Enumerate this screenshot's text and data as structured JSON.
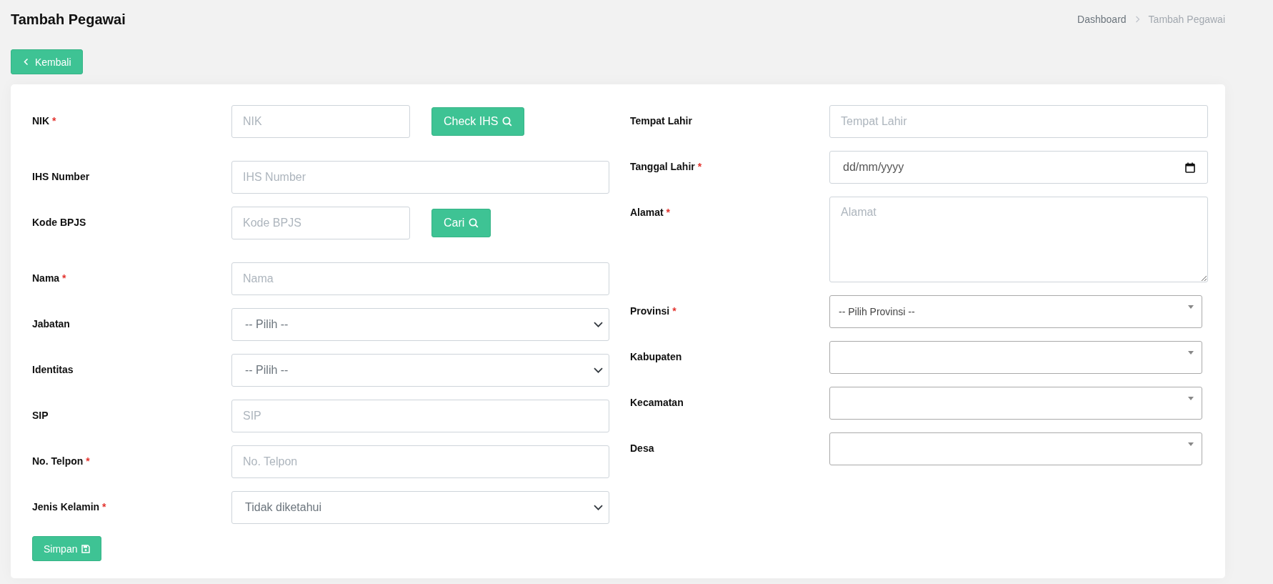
{
  "page": {
    "title": "Tambah Pegawai"
  },
  "breadcrumb": [
    {
      "label": "Dashboard",
      "active": false
    },
    {
      "label": "Tambah Pegawai",
      "active": true
    }
  ],
  "back_button": {
    "label": "Kembali"
  },
  "left_fields": [
    {
      "kind": "text",
      "label": "NIK",
      "required_mark": "*",
      "placeholder": "NIK",
      "button": "Check IHS"
    },
    {
      "kind": "text",
      "label": "IHS Number",
      "placeholder": "IHS Number"
    },
    {
      "kind": "text",
      "label": "Kode BPJS",
      "placeholder": "Kode BPJS",
      "button": "Cari"
    },
    {
      "kind": "text",
      "label": "Nama",
      "required_mark": "*",
      "placeholder": "Nama"
    },
    {
      "kind": "select",
      "label": "Jabatan",
      "value": "-- Pilih --"
    },
    {
      "kind": "select",
      "label": "Identitas",
      "value": "-- Pilih --"
    },
    {
      "kind": "text",
      "label": "SIP",
      "placeholder": "SIP"
    },
    {
      "kind": "text",
      "label": "No. Telpon",
      "required_mark": "*",
      "placeholder": "No. Telpon"
    },
    {
      "kind": "select",
      "label": "Jenis Kelamin",
      "required_mark": "*",
      "value": "Tidak diketahui"
    }
  ],
  "right_fields": [
    {
      "kind": "text",
      "label": "Tempat Lahir",
      "placeholder": "Tempat Lahir"
    },
    {
      "kind": "date",
      "label": "Tanggal Lahir",
      "required_mark": "*",
      "placeholder": "dd/mm/yyyy"
    },
    {
      "kind": "textarea",
      "label": "Alamat",
      "required_mark": "*",
      "placeholder": "Alamat"
    },
    {
      "kind": "search_select",
      "label": "Provinsi",
      "required_mark": "*",
      "value": "-- Pilih Provinsi --"
    },
    {
      "kind": "search_select",
      "label": "Kabupaten"
    },
    {
      "kind": "search_select",
      "label": "Kecamatan"
    },
    {
      "kind": "search_select",
      "label": "Desa"
    }
  ],
  "save_button": {
    "label": "Simpan"
  }
}
